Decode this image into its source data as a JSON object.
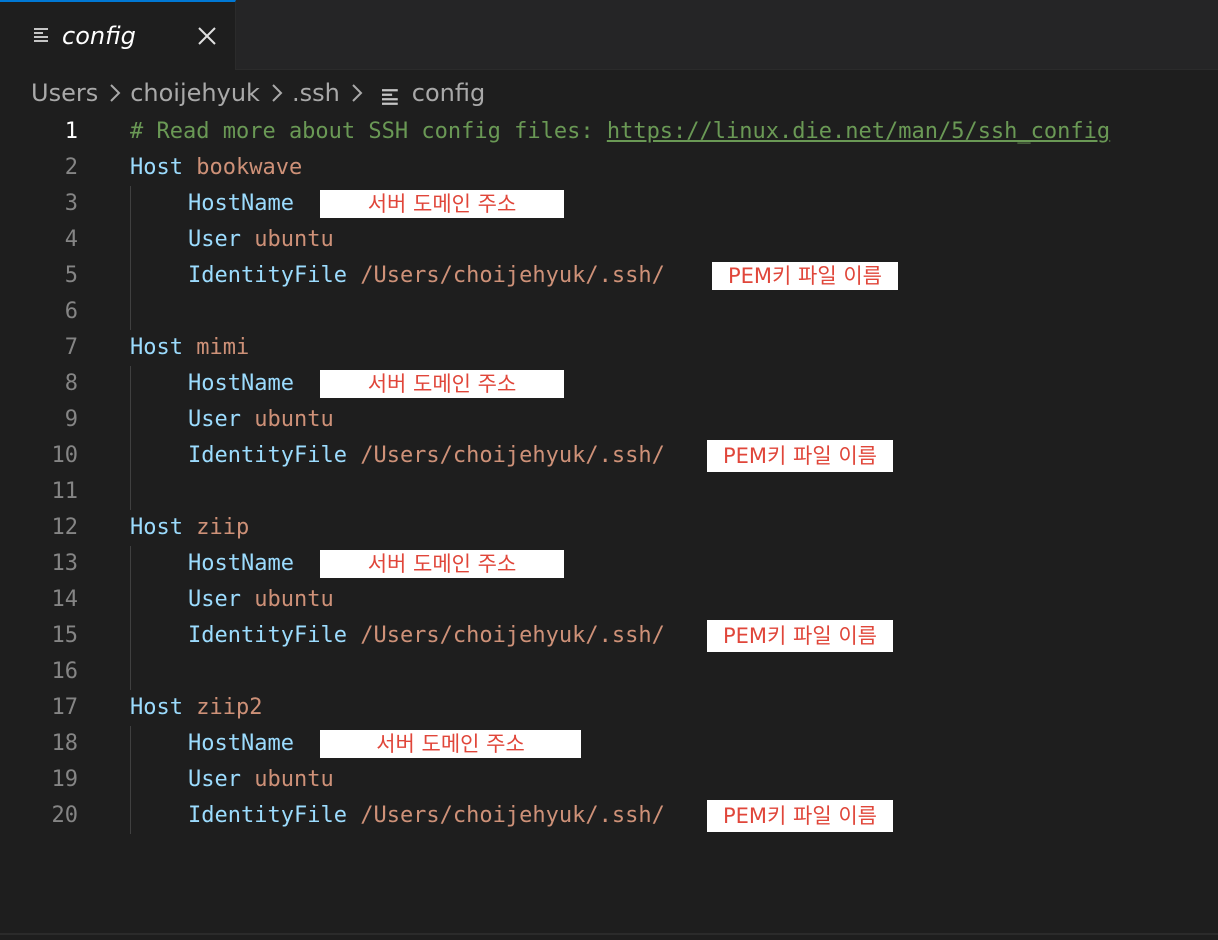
{
  "tab": {
    "label": "config",
    "icon": "file-lines-icon",
    "close_icon": "close-icon",
    "accent_color": "#0078d4"
  },
  "breadcrumb": {
    "items": [
      "Users",
      "choijehyuk",
      ".ssh"
    ],
    "file": "config"
  },
  "colors": {
    "background": "#1e1e1e",
    "comment": "#6a9955",
    "keyword": "#9cdcfe",
    "string": "#ce9178",
    "redaction_text": "#e0463a"
  },
  "editor": {
    "active_line": 1,
    "line_numbers": [
      "1",
      "2",
      "3",
      "4",
      "5",
      "6",
      "7",
      "8",
      "9",
      "10",
      "11",
      "12",
      "13",
      "14",
      "15",
      "16",
      "17",
      "18",
      "19",
      "20"
    ],
    "comment_prefix": "# Read more about SSH config files: ",
    "comment_link": "https://linux.die.net/man/5/ssh_config",
    "keywords": {
      "host": "Host",
      "hostname": "HostName",
      "user": "User",
      "identity_file": "IdentityFile"
    },
    "hosts": [
      {
        "name": "bookwave",
        "user": "ubuntu",
        "identity_path": "/Users/choijehyuk/.ssh/",
        "hostname_redaction": "서버 도메인 주소",
        "key_redaction": "PEM키 파일 이름"
      },
      {
        "name": "mimi",
        "user": "ubuntu",
        "identity_path": "/Users/choijehyuk/.ssh/",
        "hostname_redaction": "서버 도메인 주소",
        "key_redaction": "PEM키 파일 이름"
      },
      {
        "name": "ziip",
        "user": "ubuntu",
        "identity_path": "/Users/choijehyuk/.ssh/",
        "hostname_redaction": "서버 도메인 주소",
        "key_redaction": "PEM키 파일 이름"
      },
      {
        "name": "ziip2",
        "user": "ubuntu",
        "identity_path": "/Users/choijehyuk/.ssh/",
        "hostname_redaction": "서버 도메인 주소",
        "key_redaction": "PEM키 파일 이름"
      }
    ]
  }
}
